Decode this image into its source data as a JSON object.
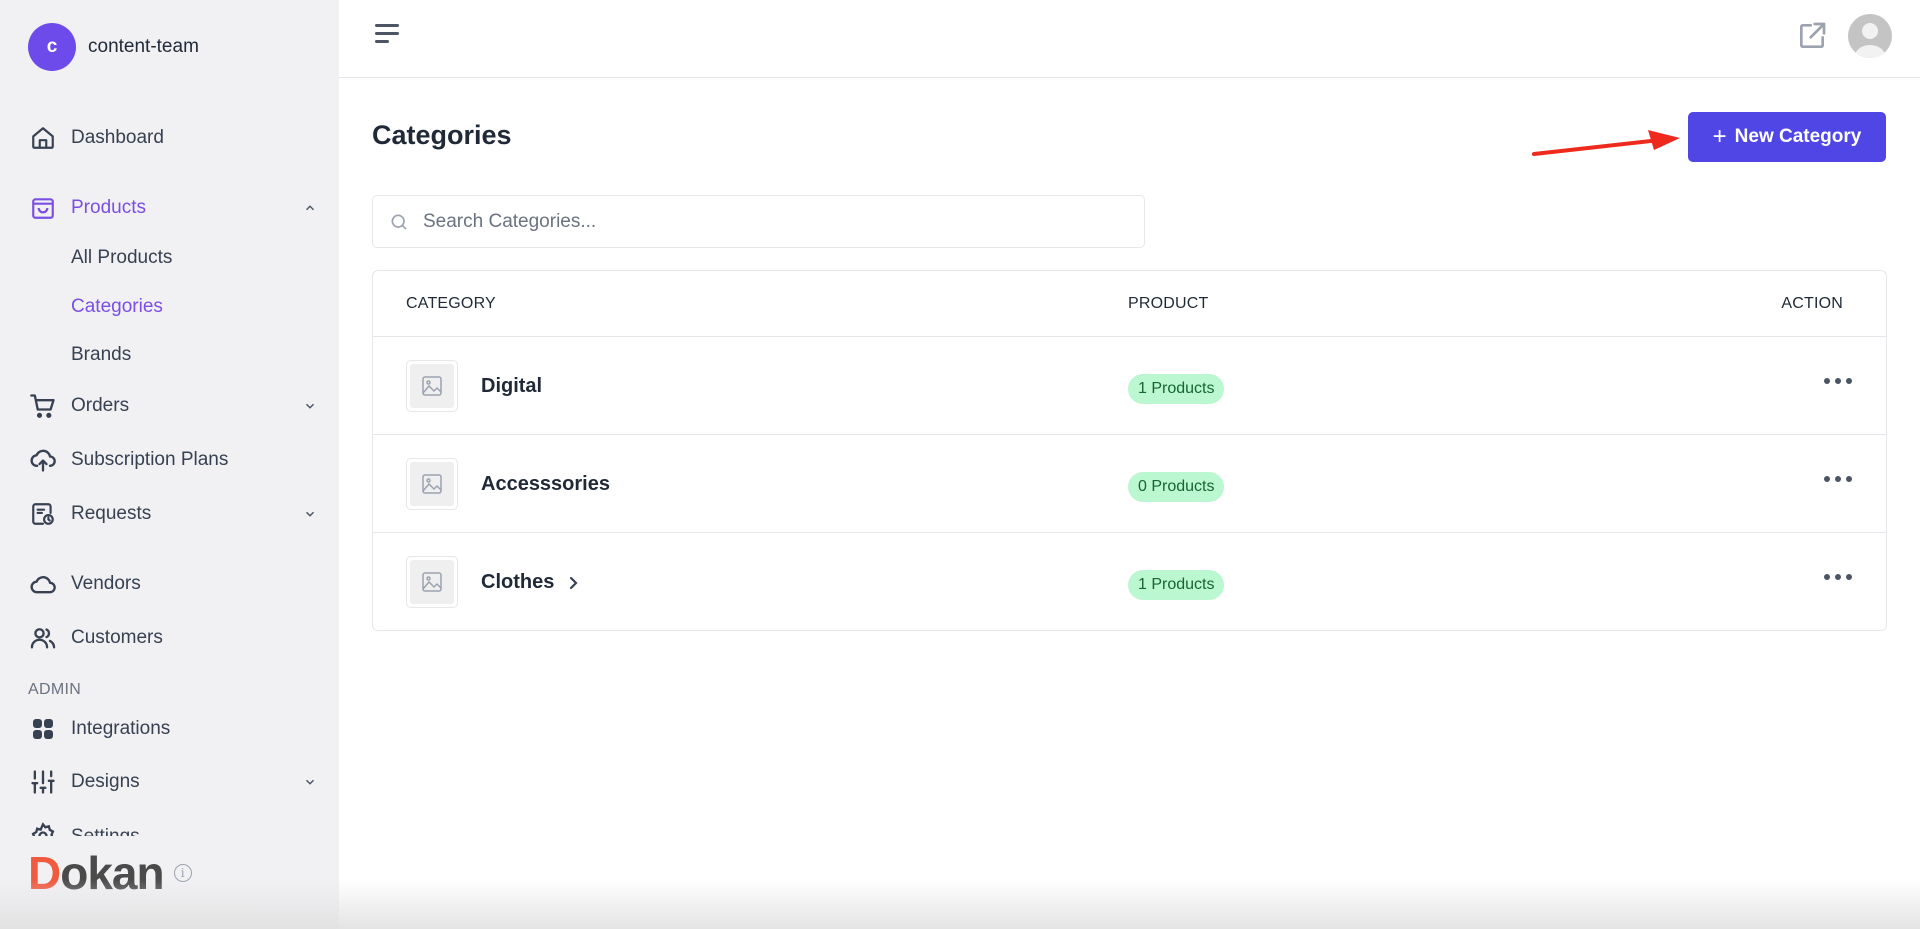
{
  "workspace": {
    "initial": "c",
    "name": "content-team"
  },
  "sidebar": {
    "items": [
      {
        "label": "Dashboard",
        "icon": "home-icon"
      },
      {
        "label": "Products",
        "icon": "shopping-bag-icon",
        "expanded": true,
        "children": [
          {
            "label": "All Products"
          },
          {
            "label": "Categories",
            "active": true
          },
          {
            "label": "Brands"
          }
        ]
      },
      {
        "label": "Orders",
        "icon": "cart-icon",
        "expandable": true
      },
      {
        "label": "Subscription Plans",
        "icon": "cloud-upload-icon"
      },
      {
        "label": "Requests",
        "icon": "request-clock-icon",
        "expandable": true
      },
      {
        "label": "Vendors",
        "icon": "cloud-icon"
      },
      {
        "label": "Customers",
        "icon": "users-icon"
      }
    ],
    "admin_label": "ADMIN",
    "admin_items": [
      {
        "label": "Integrations",
        "icon": "grid-icon"
      },
      {
        "label": "Designs",
        "icon": "sliders-icon",
        "expandable": true
      },
      {
        "label": "Settings",
        "icon": "gear-icon"
      }
    ]
  },
  "logo": {
    "first": "D",
    "rest": "okan",
    "info": "i"
  },
  "header": {
    "menu_icon": "hamburger-icon",
    "external_icon": "external-link-icon",
    "avatar_icon": "user-avatar-icon"
  },
  "page": {
    "title": "Categories",
    "new_button": {
      "plus": "+",
      "label": "New Category"
    },
    "search": {
      "placeholder": "Search Categories...",
      "value": ""
    }
  },
  "table": {
    "columns": [
      "CATEGORY",
      "PRODUCT",
      "ACTION"
    ],
    "rows": [
      {
        "name": "Digital",
        "products": "1 Products",
        "has_children": false
      },
      {
        "name": "Accesssories",
        "products": "0 Products",
        "has_children": false
      },
      {
        "name": "Clothes",
        "products": "1 Products",
        "has_children": true
      }
    ]
  },
  "colors": {
    "accent": "#7c4ee4",
    "primary_button": "#4f46e5",
    "badge_bg": "#bbf7d0",
    "badge_text": "#166534",
    "annotation_arrow": "#ee2a1c"
  }
}
